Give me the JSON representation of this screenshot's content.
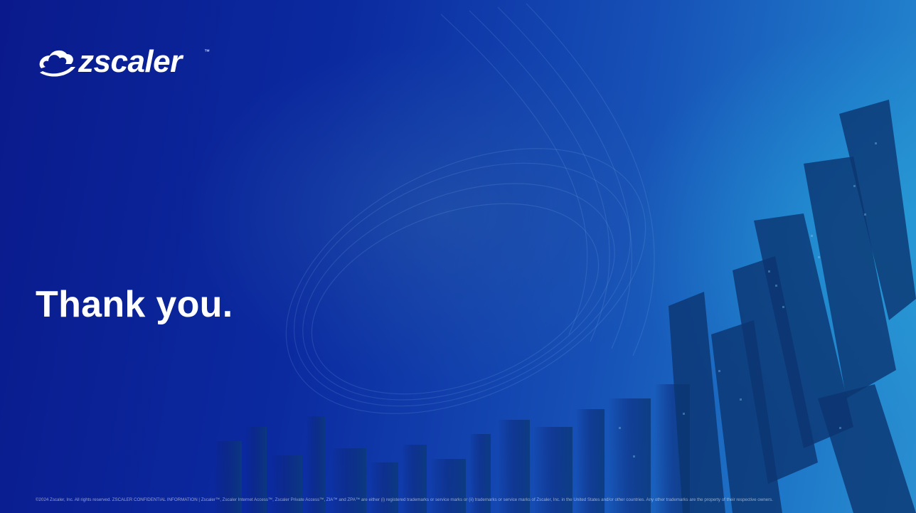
{
  "brand": {
    "name": "zscaler",
    "trademark": "™",
    "logo_icon": "zscaler-cloud-swirl-icon"
  },
  "slide": {
    "title": "Thank you."
  },
  "footer": {
    "legal": "©2024 Zscaler, Inc. All rights reserved. ZSCALER CONFIDENTIAL INFORMATION | Zscaler™, Zscaler Internet Access™, Zscaler Private Access™, ZIA™ and ZPA™ are either (i) registered trademarks or service marks or (ii) trademarks or service marks of Zscaler, Inc. in the United States and/or other countries. Any other trademarks are the property of their respective owners."
  },
  "colors": {
    "background_dark": "#0a1a8c",
    "background_light": "#2a8fd1",
    "text": "#ffffff"
  }
}
